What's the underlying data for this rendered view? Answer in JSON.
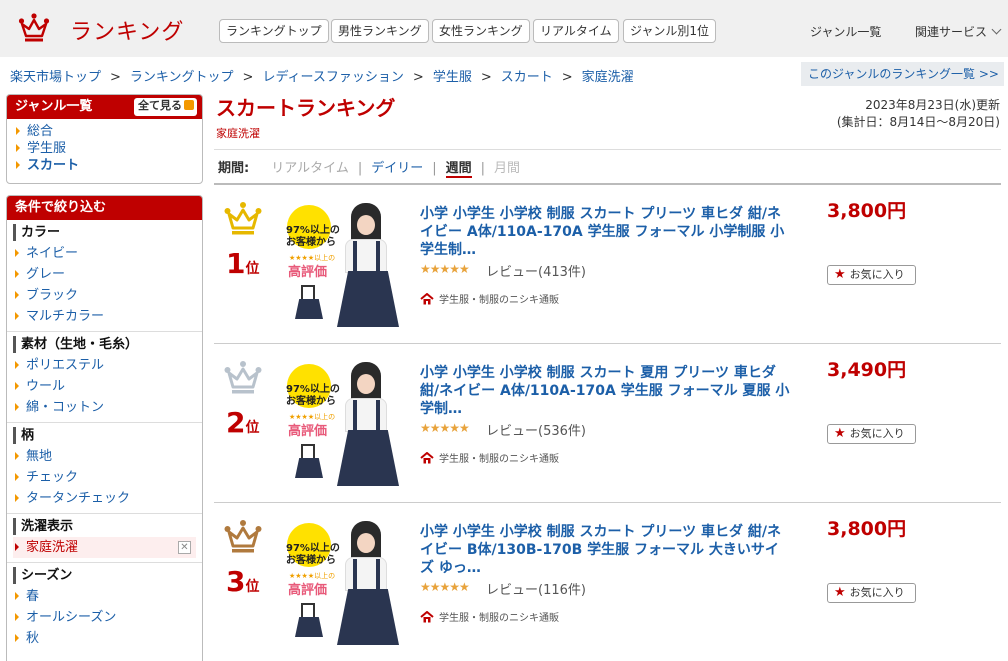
{
  "header": {
    "logo_text": "ランキング",
    "nav": [
      "ランキングトップ",
      "男性ランキング",
      "女性ランキング",
      "リアルタイム",
      "ジャンル別1位"
    ],
    "genre_list": "ジャンル一覧",
    "related": "関連サービス"
  },
  "breadcrumb": [
    "楽天市場トップ",
    "ランキングトップ",
    "レディースファッション",
    "学生服",
    "スカート",
    "家庭洗濯"
  ],
  "genre_ranking_link": "このジャンルのランキング一覧 >>",
  "sidebar": {
    "genre_title": "ジャンル一覧",
    "see_all": "全て見る",
    "genres": [
      "総合",
      "学生服",
      "スカート"
    ],
    "filter_title": "条件で絞り込む",
    "groups": [
      {
        "title": "カラー",
        "items": [
          "ネイビー",
          "グレー",
          "ブラック",
          "マルチカラー"
        ]
      },
      {
        "title": "素材（生地・毛糸）",
        "items": [
          "ポリエステル",
          "ウール",
          "綿・コットン"
        ]
      },
      {
        "title": "柄",
        "items": [
          "無地",
          "チェック",
          "タータンチェック"
        ]
      },
      {
        "title": "洗濯表示",
        "items": [
          "家庭洗濯"
        ]
      },
      {
        "title": "シーズン",
        "items": [
          "春",
          "オールシーズン",
          "秋"
        ]
      }
    ]
  },
  "main": {
    "title": "スカートランキング",
    "sub_category": "家庭洗濯",
    "updated": "2023年8月23日(水)更新",
    "period_range": "(集計日：8月14日～8月20日)",
    "period_label": "期間:",
    "periods": [
      "リアルタイム",
      "デイリー",
      "週間",
      "月間"
    ]
  },
  "badge": {
    "percent_line1": "97%以上の",
    "percent_line2": "お客様から",
    "stars": "★★★★以上の",
    "big": "高評価"
  },
  "items": [
    {
      "rank": "1",
      "rank_unit": "位",
      "title": "小学 小学生 小学校 制服 スカート プリーツ 車ヒダ 紺/ネイビー A体/110A-170A 学生服 フォーマル 小学制服 小学生制…",
      "rating": "★★★★★",
      "review": "レビュー(413件)",
      "shop": "学生服・制服のニシキ通販",
      "price": "3,800円",
      "fav": "お気に入り"
    },
    {
      "rank": "2",
      "rank_unit": "位",
      "title": "小学 小学生 小学校 制服 スカート 夏用 プリーツ 車ヒダ 紺/ネイビー A体/110A-170A 学生服 フォーマル 夏服 小学制…",
      "rating": "★★★★★",
      "review": "レビュー(536件)",
      "shop": "学生服・制服のニシキ通販",
      "price": "3,490円",
      "fav": "お気に入り"
    },
    {
      "rank": "3",
      "rank_unit": "位",
      "title": "小学 小学生 小学校 制服 スカート プリーツ 車ヒダ 紺/ネイビー B体/130B-170B 学生服 フォーマル 大きいサイズ ゆっ…",
      "rating": "★★★★★",
      "review": "レビュー(116件)",
      "shop": "学生服・制服のニシキ通販",
      "price": "3,800円",
      "fav": "お気に入り"
    }
  ],
  "colors": {
    "brand": "#bf0000",
    "link": "#1c5fa8",
    "gold": "#e6b800",
    "silver": "#b8c2cc",
    "bronze": "#b07a3e"
  }
}
